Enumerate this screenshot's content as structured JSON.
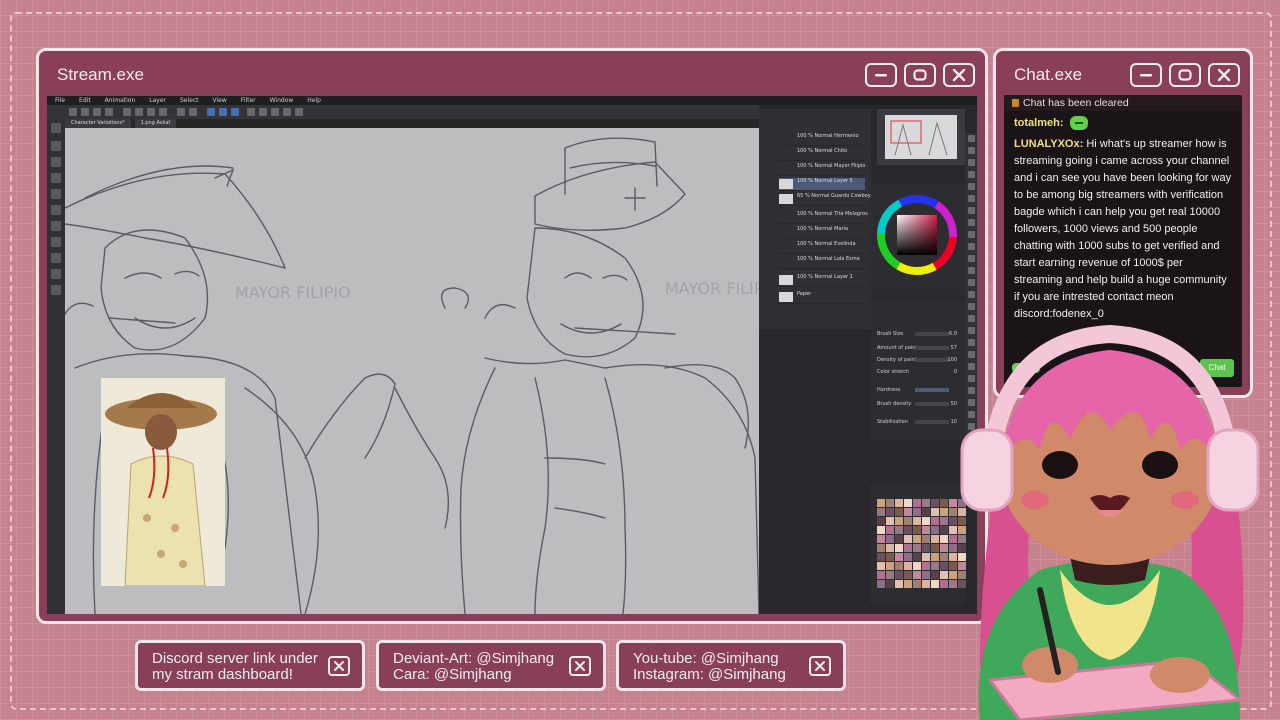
{
  "stream_window": {
    "title": "Stream.exe",
    "controls": [
      "minimize-icon",
      "maximize-icon",
      "close-icon"
    ]
  },
  "app": {
    "menu": [
      "File",
      "Edit",
      "Animation",
      "Layer",
      "Select",
      "View",
      "Filter",
      "Window",
      "Help"
    ],
    "tabs": [
      "Character Variations*",
      "1.png Avkat"
    ],
    "layers": [
      {
        "label": "100 % Normal\nHermenio"
      },
      {
        "label": "100 % Normal\nChito"
      },
      {
        "label": "100 % Normal\nMayor Filipio"
      },
      {
        "label": "100 % Normal\nLayer 5"
      },
      {
        "label": "65 % Normal\nGuardo Cowboy"
      },
      {
        "label": "100 % Normal\nTita Melagros"
      },
      {
        "label": "100 % Normal\nMaria"
      },
      {
        "label": "100 % Normal\nEvelinda"
      },
      {
        "label": "100 % Normal\nLola Esme"
      },
      {
        "label": "100 % Normal\nLayer 1"
      },
      {
        "label": "Paper"
      }
    ],
    "tool_property": [
      {
        "label": "Brush Size",
        "value": "6.0"
      },
      {
        "label": "Amount of paint",
        "value": "57"
      },
      {
        "label": "Density of paint",
        "value": "100"
      },
      {
        "label": "Color stretch",
        "value": "0"
      },
      {
        "label": "Hardness",
        "value": ""
      },
      {
        "label": "Brush density",
        "value": "50"
      },
      {
        "label": "Stabilization",
        "value": "10"
      }
    ],
    "canvas_text": [
      "MAYOR FILIPIO",
      "MAYOR FILIPIO"
    ]
  },
  "chat_window": {
    "title": "Chat.exe",
    "cleared_notice": "Chat has been cleared",
    "messages": [
      {
        "user": "totalmeh:",
        "text": "",
        "emote": "green-face-emote"
      },
      {
        "user": "LUNALYXOx:",
        "text": "Hi what's up streamer how is streaming going i came across your channel and i can see you have been looking for way to be among big streamers with verification bagde which i can help you get real 10000 followers, 1000 views and 500 people chatting with 1000 subs to get verified and start earning revenue of 1000$ per streaming and help build a huge community if you are intrested contact meon discord:fodenex_0"
      }
    ],
    "send_label": "Chat"
  },
  "info_boxes": [
    {
      "line1": "Discord server link under",
      "line2": "my stram dashboard!"
    },
    {
      "line1": "Deviant-Art: @Simjhang",
      "line2": "Cara: @Simjhang"
    },
    {
      "line1": "You-tube: @Simjhang",
      "line2": "Instagram: @Simjhang"
    }
  ],
  "colors": {
    "window_bg": "#8a3f58",
    "window_border": "#f3e6ea",
    "page_bg": "#c6838f",
    "chat_bg": "#1a1418",
    "username": "#f0e070",
    "send_button": "#5ec24e"
  }
}
